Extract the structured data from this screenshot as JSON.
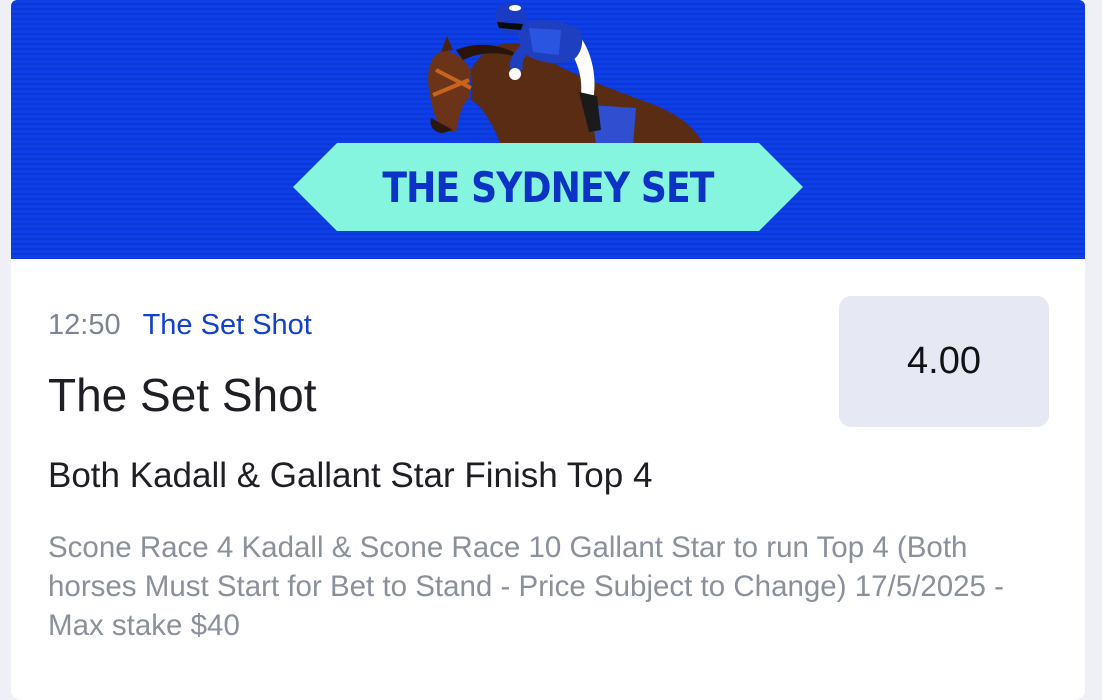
{
  "banner": {
    "label": "THE SYDNEY SET",
    "background_color": "#0d3ee6",
    "ribbon_color": "#85f5e0",
    "icon": "horse-and-jockey-illustration"
  },
  "market": {
    "time": "12:50",
    "link_label": "The Set Shot",
    "title": "The Set Shot",
    "odds": "4.00",
    "selection": "Both Kadall & Gallant Star Finish Top 4",
    "description": "Scone Race 4 Kadall & Scone Race 10 Gallant Star to run Top 4 (Both horses Must Start for Bet to Stand - Price Subject to Change) 17/5/2025 - Max stake $40"
  }
}
